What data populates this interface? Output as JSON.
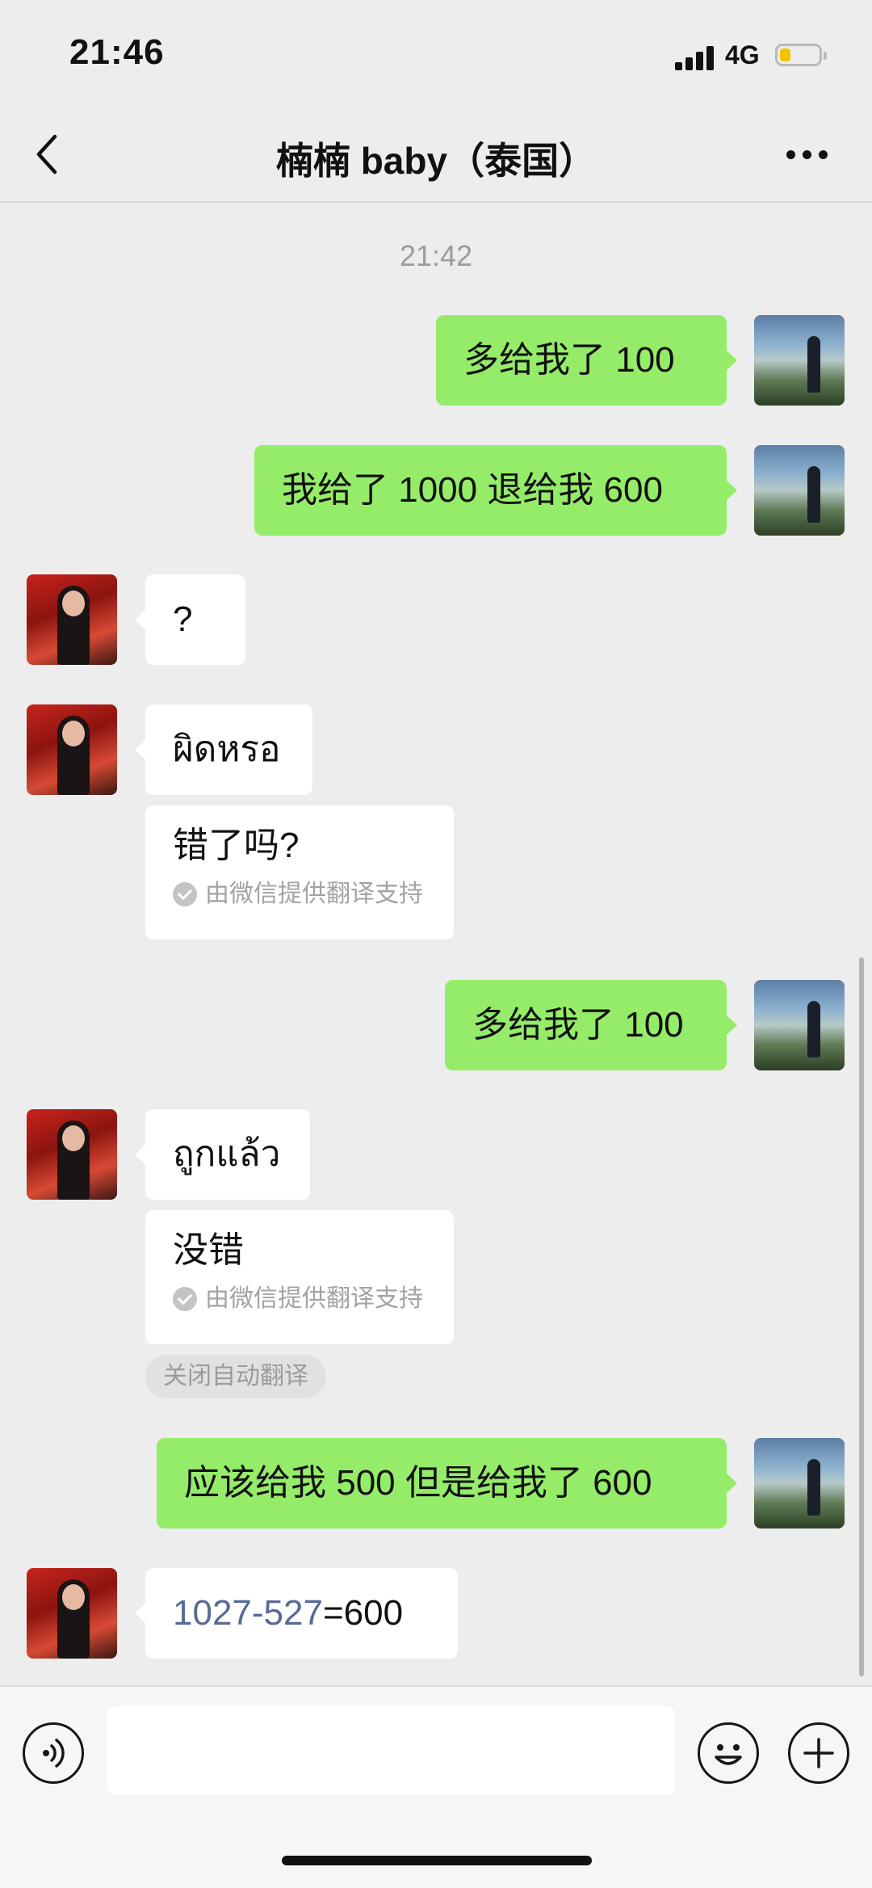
{
  "status_bar": {
    "time": "21:46",
    "network": "4G",
    "icons": [
      "signal-icon",
      "battery-icon"
    ]
  },
  "nav": {
    "title": "楠楠 baby（泰国）",
    "back_icon": "chevron-left-icon",
    "more_icon": "more-icon"
  },
  "chat": {
    "timestamp": "21:42",
    "messages": [
      {
        "from": "me",
        "text": "多给我了 100"
      },
      {
        "from": "me",
        "text": "我给了 1000 退给我 600"
      },
      {
        "from": "them",
        "text": "?"
      },
      {
        "from": "them",
        "text": "ผิดหรอ",
        "translation": "错了吗?",
        "translation_note": "由微信提供翻译支持"
      },
      {
        "from": "me",
        "text": "多给我了 100"
      },
      {
        "from": "them",
        "text": "ถูกแล้ว",
        "translation": "没错",
        "translation_note": "由微信提供翻译支持"
      },
      {
        "from": "me",
        "text": "应该给我 500 但是给我了 600"
      },
      {
        "from": "them",
        "text_link": "1027-527",
        "text_rest": "=600"
      }
    ],
    "close_translate_label": "关闭自动翻译"
  },
  "input_bar": {
    "value": "",
    "icons": [
      "voice-icon",
      "emoji-icon",
      "plus-icon"
    ]
  },
  "colors": {
    "background": "#ededed",
    "bubble_me": "#95ec69",
    "bubble_them": "#ffffff",
    "link": "#576b95"
  }
}
